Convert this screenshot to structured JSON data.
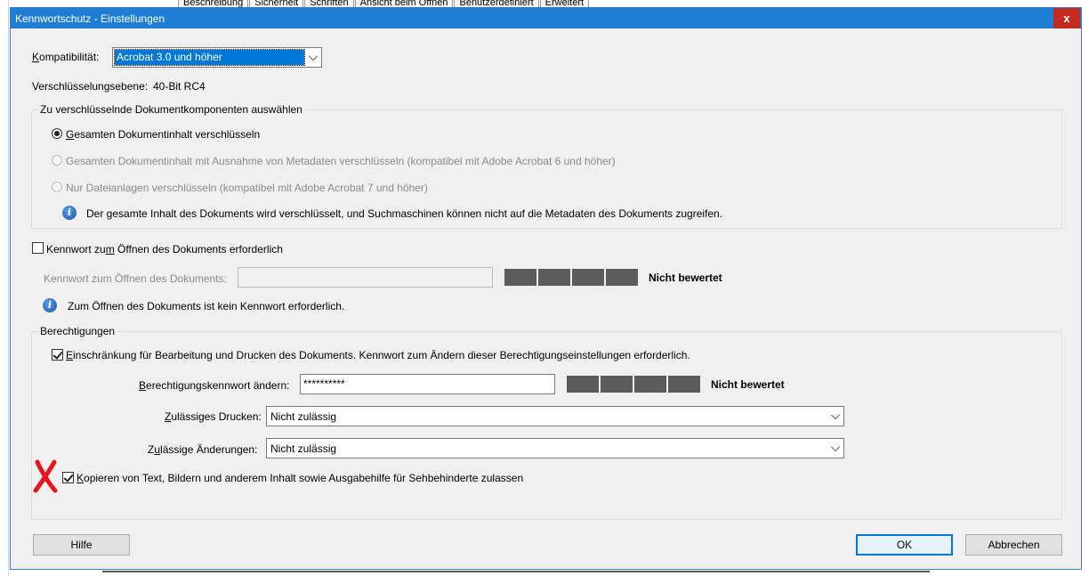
{
  "background_tabs": [
    "Beschreibung",
    "Sicherheit",
    "Schriften",
    "Ansicht beim Öffnen",
    "Benutzerdefiniert",
    "Erweitert"
  ],
  "dialog": {
    "title": "Kennwortschutz - Einstellungen",
    "close_label": "x"
  },
  "compatibility": {
    "label_pre": "",
    "label_u": "K",
    "label_post": "ompatibilität:",
    "value": "Acrobat 3.0 und höher"
  },
  "encryption": {
    "label": "Verschlüsselungsebene:",
    "value": "40-Bit RC4"
  },
  "components": {
    "legend": "Zu verschlüsselnde Dokumentkomponenten auswählen",
    "option1_u": "G",
    "option1_rest": "esamten Dokumentinhalt verschlüsseln",
    "option2": "Gesamten Dokumentinhalt mit Ausnahme von Metadaten verschlüsseln (kompatibel mit Adobe Acrobat 6 und höher)",
    "option3": "Nur Dateianlagen verschlüsseln (kompatibel mit Adobe Acrobat 7 und höher)",
    "info": "Der gesamte Inhalt des Dokuments wird verschlüsselt, und Suchmaschinen können nicht auf die Metadaten des Dokuments zugreifen."
  },
  "open_password": {
    "checkbox_pre": "Kennwort zu",
    "checkbox_u": "m",
    "checkbox_post": " Öffnen des Dokuments erforderlich",
    "field_label": "Kennwort zum Öffnen des Dokuments:",
    "value": "",
    "rating": "Nicht bewertet",
    "info": "Zum Öffnen des Dokuments ist kein Kennwort erforderlich."
  },
  "permissions": {
    "legend": "Berechtigungen",
    "restrict_u": "E",
    "restrict_rest": "inschränkung für Bearbeitung und Drucken des Dokuments. Kennwort zum Ändern dieser Berechtigungseinstellungen erforderlich.",
    "password_label_pre": "",
    "password_label_u": "B",
    "password_label_post": "erechtigungskennwort ändern:",
    "password_value": "**********",
    "rating": "Nicht bewertet",
    "printing_label_u": "Z",
    "printing_label_rest": "ulässiges Drucken:",
    "printing_value": "Nicht zulässig",
    "changes_label_pre": "Z",
    "changes_label_u": "u",
    "changes_label_rest": "lässige Änderungen:",
    "changes_value": "Nicht zulässig",
    "copy_u": "K",
    "copy_rest": "opieren von Text, Bildern und anderem Inhalt sowie Ausgabehilfe für Sehbehinderte zulassen"
  },
  "buttons": {
    "help": "Hilfe",
    "ok": "OK",
    "cancel": "Abbrechen"
  },
  "colors": {
    "titlebar": "#1d7ed4",
    "close": "#c42b1c",
    "selection": "#0078d7",
    "annotation_x": "#e8141c"
  }
}
